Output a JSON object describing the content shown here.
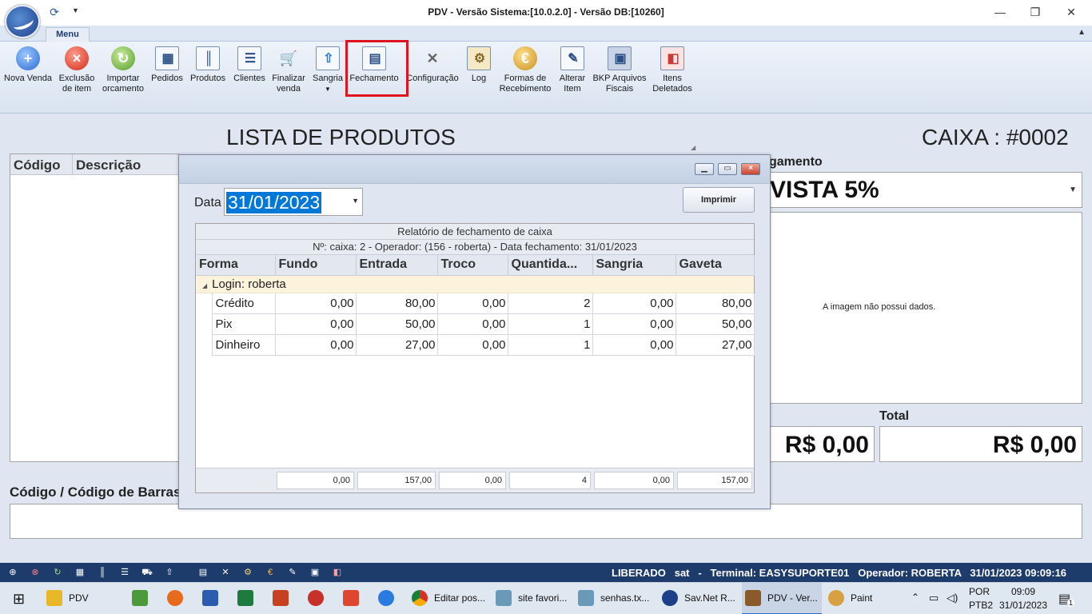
{
  "window": {
    "title": "PDV - Versão Sistema:[10.0.2.0] - Versão DB:[10260]",
    "controls": {
      "minimize": "—",
      "restore": "❐",
      "close": "✕"
    }
  },
  "ribbon": {
    "tab": "Menu",
    "buttons": [
      {
        "label": "Nova Venda",
        "icon": "plus-circle-icon"
      },
      {
        "label": "Exclusão de item",
        "icon": "remove-circle-icon"
      },
      {
        "label": "Importar orcamento",
        "icon": "import-icon"
      },
      {
        "label": "Pedidos",
        "icon": "orders-icon"
      },
      {
        "label": "Produtos",
        "icon": "barcode-icon"
      },
      {
        "label": "Clientes",
        "icon": "clients-card-icon"
      },
      {
        "label": "Finalizar venda",
        "icon": "cart-icon"
      },
      {
        "label": "Sangria",
        "icon": "withdraw-icon"
      },
      {
        "label": "Fechamento",
        "icon": "calculator-icon"
      },
      {
        "label": "Configuração",
        "icon": "tools-icon"
      },
      {
        "label": "Log",
        "icon": "log-icon"
      },
      {
        "label": "Formas de Recebimento",
        "icon": "coins-icon"
      },
      {
        "label": "Alterar Item",
        "icon": "edit-icon"
      },
      {
        "label": "BKP Arquivos Fiscais",
        "icon": "save-icon"
      },
      {
        "label": "Itens Deletados",
        "icon": "eraser-icon"
      }
    ]
  },
  "main": {
    "lista_title": "LISTA DE PRODUTOS",
    "caixa_title": "CAIXA : #0002",
    "grid_columns": [
      "Código",
      "Descrição"
    ],
    "codigo_label": "Código / Código de Barras",
    "pagamento_label": "gamento",
    "pagamento_value": "VISTA 5%",
    "image_empty_text": "A imagem não possui dados.",
    "total_label": "Total",
    "subtotal_value": "R$ 0,00",
    "total_value": "R$ 0,00"
  },
  "dialog": {
    "data_label": "Data",
    "date_value": "31/01/2023",
    "print_button": "Imprimir",
    "report_title": "Relatório de fechamento de caixa",
    "report_subtitle": "Nº: caixa: 2 - Operador: (156 - roberta) - Data fechamento: 31/01/2023",
    "columns": [
      "Forma",
      "Fundo",
      "Entrada",
      "Troco",
      "Quantida...",
      "Sangria",
      "Gaveta"
    ],
    "group_label": "Login: roberta",
    "rows": [
      [
        "Crédito",
        "0,00",
        "80,00",
        "0,00",
        "2",
        "0,00",
        "80,00"
      ],
      [
        "Pix",
        "0,00",
        "50,00",
        "0,00",
        "1",
        "0,00",
        "50,00"
      ],
      [
        "Dinheiro",
        "0,00",
        "27,00",
        "0,00",
        "1",
        "0,00",
        "27,00"
      ]
    ],
    "totals": [
      "0,00",
      "157,00",
      "0,00",
      "4",
      "0,00",
      "157,00"
    ]
  },
  "statusbar": {
    "text": "LIBERADO   sat   -   Terminal: EASYSUPORTE01   Operador: ROBERTA   31/01/2023 09:09:16"
  },
  "taskbar": {
    "items": [
      {
        "label": "PDV",
        "color": "#e8b828"
      },
      {
        "label": "",
        "color": "#4c9a3c"
      },
      {
        "label": "",
        "color": "#e86a1c"
      },
      {
        "label": "",
        "color": "#2b5cad"
      },
      {
        "label": "",
        "color": "#1f7a40"
      },
      {
        "label": "",
        "color": "#c7401f"
      },
      {
        "label": "",
        "color": "#c8302a"
      },
      {
        "label": "",
        "color": "#e0452f"
      },
      {
        "label": "",
        "color": "#2a7ae0"
      },
      {
        "label": "Editar pos...",
        "color": "#3c8de0"
      },
      {
        "label": "site favori...",
        "color": "#6a9ab8"
      },
      {
        "label": "senhas.tx...",
        "color": "#6a9ab8"
      },
      {
        "label": "Sav.Net R...",
        "color": "#1c3f8a"
      },
      {
        "label": "PDV - Ver...",
        "color": "#8a5a2a"
      },
      {
        "label": "Paint",
        "color": "#d8a040"
      }
    ],
    "lang_top": "POR",
    "lang_bottom": "PTB2",
    "time": "09:09",
    "date": "31/01/2023",
    "notification_count": "1"
  }
}
